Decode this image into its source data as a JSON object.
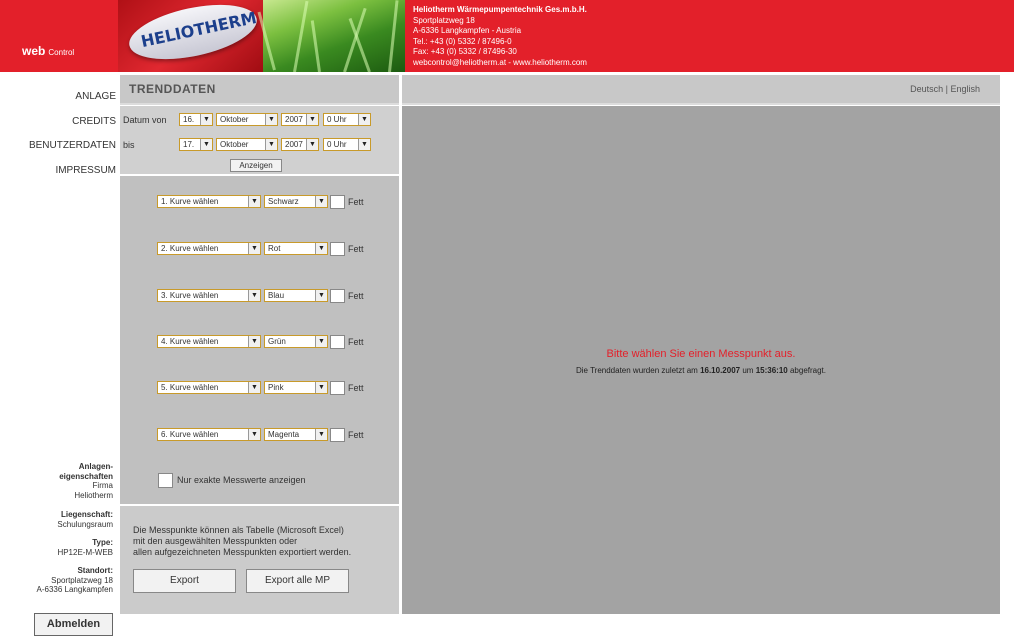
{
  "header": {
    "web": "web",
    "control": "Control",
    "logo_text": "HELIOTHERM",
    "company_name": "Heliotherm Wärmepumpentechnik Ges.m.b.H.",
    "street": "Sportplatzweg 18",
    "city": "A-6336 Langkampfen - Austria",
    "tel": "Tel.: +43 (0) 5332 / 87496-0",
    "fax": "Fax: +43 (0) 5332 / 87496-30",
    "web_line": "webcontrol@heliotherm.at - www.heliotherm.com"
  },
  "nav": {
    "anlage": "ANLAGE",
    "credits": "CREDITS",
    "benutzerdaten": "BENUTZERDATEN",
    "impressum": "IMPRESSUM"
  },
  "info": {
    "anlagen_label_1": "Anlagen-",
    "anlagen_label_2": "eigenschaften",
    "firma": "Firma",
    "firma_value": "Heliotherm",
    "liegenschaft_label": "Liegenschaft:",
    "liegenschaft_value": "Schulungsraum",
    "type_label": "Type:",
    "type_value": "HP12E-M-WEB",
    "standort_label": "Standort:",
    "standort_line1": "Sportplatzweg 18",
    "standort_line2": "A-6336 Langkampfen"
  },
  "logout_label": "Abmelden",
  "title": "TRENDDATEN",
  "lang": "Deutsch | English",
  "date": {
    "from_label": "Datum von",
    "to_label": "bis",
    "from_day": "16.",
    "from_month": "Oktober",
    "from_year": "2007",
    "from_hour": "0 Uhr",
    "to_day": "17.",
    "to_month": "Oktober",
    "to_year": "2007",
    "to_hour": "0 Uhr",
    "show_button": "Anzeigen"
  },
  "curves": [
    {
      "curve": "1. Kurve wählen",
      "color": "Schwarz",
      "bold": "Fett"
    },
    {
      "curve": "2. Kurve wählen",
      "color": "Rot",
      "bold": "Fett"
    },
    {
      "curve": "3. Kurve wählen",
      "color": "Blau",
      "bold": "Fett"
    },
    {
      "curve": "4. Kurve wählen",
      "color": "Grün",
      "bold": "Fett"
    },
    {
      "curve": "5. Kurve wählen",
      "color": "Pink",
      "bold": "Fett"
    },
    {
      "curve": "6. Kurve wählen",
      "color": "Magenta",
      "bold": "Fett"
    }
  ],
  "exact_values_label": "Nur exakte Messwerte anzeigen",
  "export": {
    "text_line1": "Die Messpunkte können als Tabelle (Microsoft Excel)",
    "text_line2": "mit den ausgewählten Messpunkten oder",
    "text_line3": "allen aufgezeichneten Messpunkten exportiert werden.",
    "export_button": "Export",
    "export_all_button": "Export alle MP"
  },
  "main": {
    "prompt": "Bitte wählen Sie einen Messpunkt aus.",
    "info_prefix": "Die Trenddaten wurden zuletzt am",
    "info_date": "16.10.2007",
    "info_mid": "um",
    "info_time": "15:36:10",
    "info_suffix": "abgefragt."
  },
  "colors": {
    "brand_red": "#e3202a",
    "panel_gray": "#c0c0c0",
    "main_gray": "#a3a3a3",
    "select_border": "#c89a2a"
  }
}
